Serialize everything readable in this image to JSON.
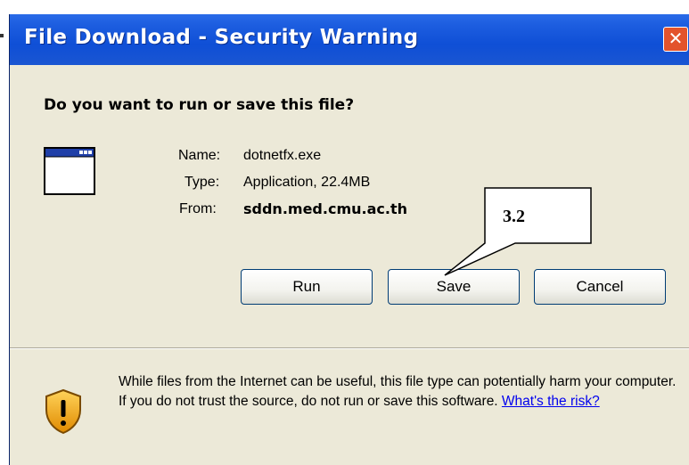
{
  "window": {
    "title": "File Download - Security Warning",
    "close_glyph": "✕"
  },
  "prompt": {
    "question": "Do you want to run or save this file?"
  },
  "file": {
    "icon": "application-window-icon",
    "name_label": "Name:",
    "name_value": "dotnetfx.exe",
    "type_label": "Type:",
    "type_value": "Application, 22.4MB",
    "from_label": "From:",
    "from_value": "sddn.med.cmu.ac.th"
  },
  "buttons": {
    "run": "Run",
    "save": "Save",
    "cancel": "Cancel"
  },
  "warning": {
    "icon": "shield-warning-icon",
    "text": "While files from the Internet can be useful, this file type can potentially harm your computer. If you do not trust the source, do not run or save this software. ",
    "link": "What's the risk?"
  },
  "annotation": {
    "callout_label": "3.2"
  },
  "colors": {
    "titlebar": "#0f4fd6",
    "dialog_bg": "#ece9d8",
    "close_button": "#e3532c",
    "link": "#0000ee"
  }
}
